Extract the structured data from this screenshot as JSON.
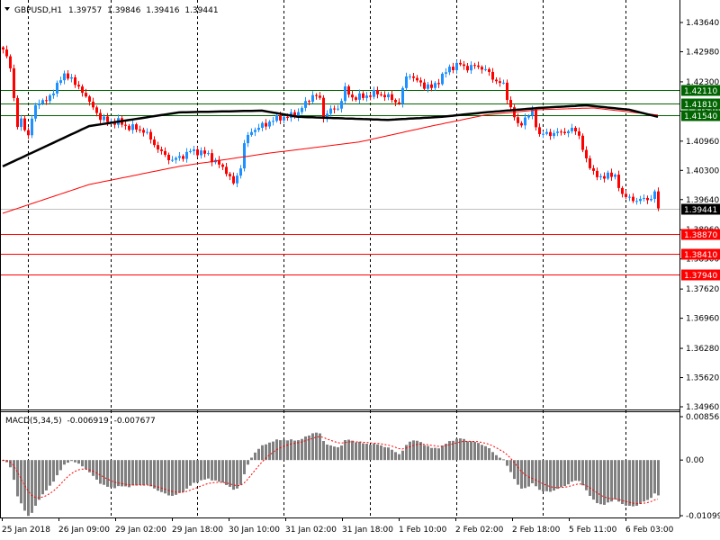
{
  "header": {
    "symbol": "GBPUSD,H1",
    "open": "1.39757",
    "high": "1.39846",
    "low": "1.39416",
    "close": "1.39441"
  },
  "macd_header": {
    "label": "MACD(5,34,5)",
    "main": "-0.006919",
    "signal": "-0.007677"
  },
  "colors": {
    "bull": "#1e90ff",
    "bear": "#ff0000",
    "ma_slow": "#000000",
    "ma_fast": "#ff0000",
    "level_green": "#006400",
    "level_red": "#ff0000",
    "histogram": "#808080"
  },
  "chart_data": {
    "type": "candlestick",
    "title": "GBPUSD,H1",
    "ylim": [
      1.3496,
      1.4364
    ],
    "price_ticks": [
      "1.43640",
      "1.42980",
      "1.42300",
      "1.41640",
      "1.40960",
      "1.40300",
      "1.39640",
      "1.38960",
      "1.38300",
      "1.37620",
      "1.36960",
      "1.36280",
      "1.35620",
      "1.34960"
    ],
    "time_ticks": [
      "25 Jan 2018",
      "26 Jan 09:00",
      "29 Jan 02:00",
      "29 Jan 18:00",
      "30 Jan 10:00",
      "31 Jan 02:00",
      "31 Jan 18:00",
      "1 Feb 10:00",
      "2 Feb 02:00",
      "2 Feb 18:00",
      "5 Feb 11:00",
      "6 Feb 03:00"
    ],
    "bar_count": 183,
    "close_anchors": [
      [
        0,
        1.4303
      ],
      [
        2,
        1.4262
      ],
      [
        4,
        1.413
      ],
      [
        5,
        1.414
      ],
      [
        7,
        1.411
      ],
      [
        8,
        1.415
      ],
      [
        10,
        1.4187
      ],
      [
        13,
        1.4191
      ],
      [
        15,
        1.4228
      ],
      [
        17,
        1.4242
      ],
      [
        19,
        1.4242
      ],
      [
        20,
        1.4222
      ],
      [
        23,
        1.4201
      ],
      [
        24,
        1.4181
      ],
      [
        27,
        1.415
      ],
      [
        29,
        1.414
      ],
      [
        32,
        1.414
      ],
      [
        34,
        1.413
      ],
      [
        37,
        1.4124
      ],
      [
        39,
        1.412
      ],
      [
        42,
        1.409
      ],
      [
        44,
        1.4069
      ],
      [
        47,
        1.4053
      ],
      [
        49,
        1.4059
      ],
      [
        52,
        1.4073
      ],
      [
        54,
        1.4073
      ],
      [
        57,
        1.4065
      ],
      [
        59,
        1.4049
      ],
      [
        62,
        1.4029
      ],
      [
        64,
        1.3998
      ],
      [
        66,
        1.4039
      ],
      [
        67,
        1.409
      ],
      [
        69,
        1.412
      ],
      [
        72,
        1.413
      ],
      [
        74,
        1.414
      ],
      [
        77,
        1.415
      ],
      [
        79,
        1.415
      ],
      [
        82,
        1.4161
      ],
      [
        84,
        1.4181
      ],
      [
        86,
        1.4201
      ],
      [
        88,
        1.4191
      ],
      [
        89,
        1.415
      ],
      [
        90,
        1.4161
      ],
      [
        93,
        1.4171
      ],
      [
        95,
        1.4212
      ],
      [
        97,
        1.4195
      ],
      [
        99,
        1.4195
      ],
      [
        102,
        1.4201
      ],
      [
        104,
        1.4205
      ],
      [
        107,
        1.4195
      ],
      [
        109,
        1.4187
      ],
      [
        110,
        1.4181
      ],
      [
        112,
        1.4242
      ],
      [
        113,
        1.4248
      ],
      [
        114,
        1.4236
      ],
      [
        117,
        1.4222
      ],
      [
        119,
        1.4216
      ],
      [
        122,
        1.4242
      ],
      [
        124,
        1.4262
      ],
      [
        127,
        1.4269
      ],
      [
        129,
        1.4262
      ],
      [
        132,
        1.4266
      ],
      [
        134,
        1.4256
      ],
      [
        137,
        1.4232
      ],
      [
        139,
        1.4222
      ],
      [
        141,
        1.4171
      ],
      [
        143,
        1.413
      ],
      [
        144,
        1.414
      ],
      [
        147,
        1.4161
      ],
      [
        149,
        1.411
      ],
      [
        152,
        1.4114
      ],
      [
        154,
        1.4114
      ],
      [
        157,
        1.412
      ],
      [
        159,
        1.412
      ],
      [
        160,
        1.411
      ],
      [
        162,
        1.4049
      ],
      [
        164,
        1.4029
      ],
      [
        166,
        1.4008
      ],
      [
        168,
        1.4025
      ],
      [
        170,
        1.4012
      ],
      [
        172,
        1.3978
      ],
      [
        174,
        1.3964
      ],
      [
        177,
        1.3964
      ],
      [
        179,
        1.3964
      ],
      [
        181,
        1.3978
      ],
      [
        182,
        1.39441
      ]
    ],
    "ma_slow_anchors": [
      [
        0,
        1.4039
      ],
      [
        24,
        1.413
      ],
      [
        49,
        1.4161
      ],
      [
        72,
        1.4165
      ],
      [
        82,
        1.4151
      ],
      [
        107,
        1.4144
      ],
      [
        122,
        1.4151
      ],
      [
        134,
        1.4161
      ],
      [
        149,
        1.4171
      ],
      [
        162,
        1.4177
      ],
      [
        174,
        1.4167
      ],
      [
        182,
        1.4151
      ]
    ],
    "ma_fast_anchors": [
      [
        0,
        1.3933
      ],
      [
        24,
        1.3998
      ],
      [
        49,
        1.4039
      ],
      [
        74,
        1.4069
      ],
      [
        99,
        1.4094
      ],
      [
        119,
        1.413
      ],
      [
        134,
        1.4155
      ],
      [
        149,
        1.4167
      ],
      [
        164,
        1.4171
      ],
      [
        182,
        1.4155
      ]
    ],
    "levels": [
      {
        "price": "1.42110",
        "color": "green"
      },
      {
        "price": "1.41810",
        "color": "green"
      },
      {
        "price": "1.41540",
        "color": "green"
      },
      {
        "price": "1.38870",
        "color": "red"
      },
      {
        "price": "1.38410",
        "color": "red"
      },
      {
        "price": "1.37940",
        "color": "red"
      }
    ],
    "current_price": "1.39441",
    "macd": {
      "params": [
        5,
        34,
        5
      ],
      "ylim": [
        -0.010995,
        0.008568
      ],
      "ticks": [
        "0.008568",
        "0.00",
        "-0.010995"
      ]
    }
  }
}
